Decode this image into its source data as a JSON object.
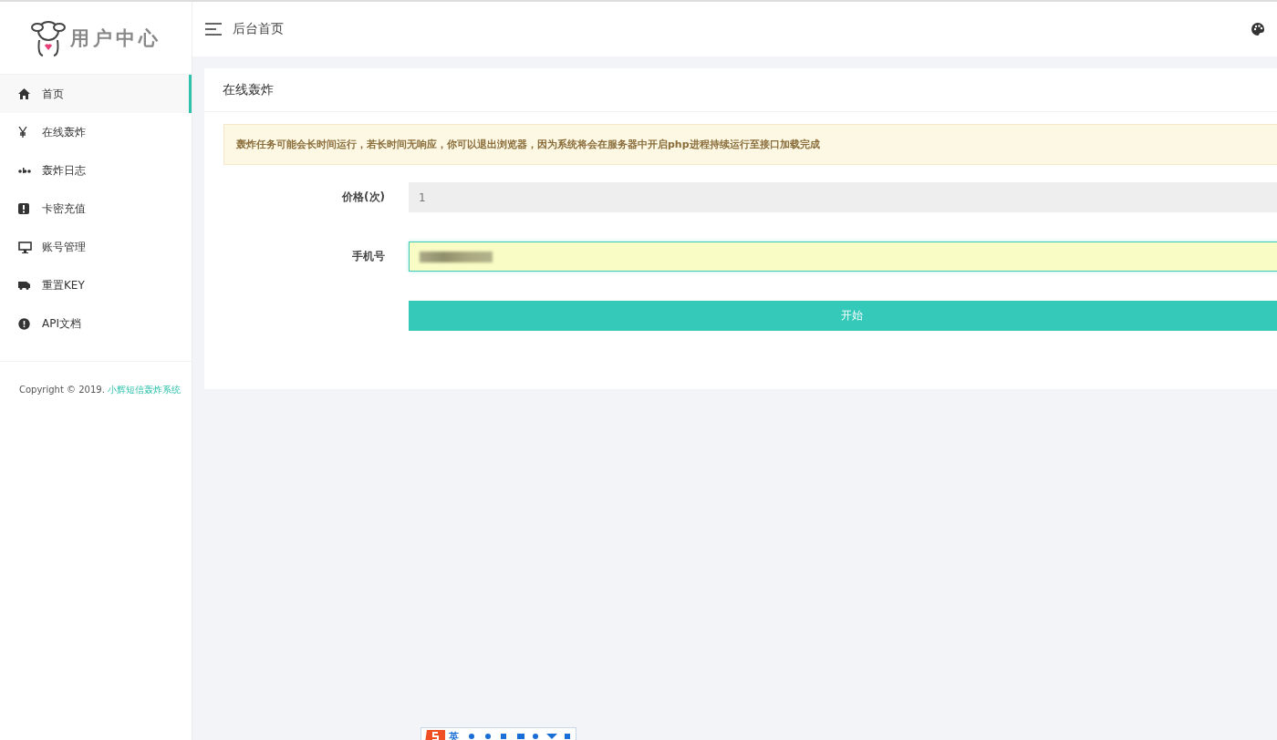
{
  "sidebar": {
    "logo_text": "用户中心",
    "items": [
      {
        "label": "首页",
        "selected": true
      },
      {
        "label": "在线轰炸",
        "selected": false
      },
      {
        "label": "轰炸日志",
        "selected": false
      },
      {
        "label": "卡密充值",
        "selected": false
      },
      {
        "label": "账号管理",
        "selected": false
      },
      {
        "label": "重置KEY",
        "selected": false
      },
      {
        "label": "API文档",
        "selected": false
      }
    ],
    "copyright": "Copyright © 2019. ",
    "copyright_link": "小辉短信轰炸系统"
  },
  "header": {
    "title": "后台首页"
  },
  "card": {
    "title": "在线轰炸",
    "alert": "轰炸任务可能会长时间运行，若长时间无响应，你可以退出浏览器，因为系统将会在服务器中开启php进程持续运行至接口加载完成",
    "fields": [
      {
        "label": "价格(次)",
        "value": "1",
        "disabled": true,
        "redacted": false
      },
      {
        "label": "手机号",
        "disabled": false,
        "redacted": true
      }
    ],
    "button": "开始"
  },
  "ime_toolbar": {
    "label": "英"
  }
}
